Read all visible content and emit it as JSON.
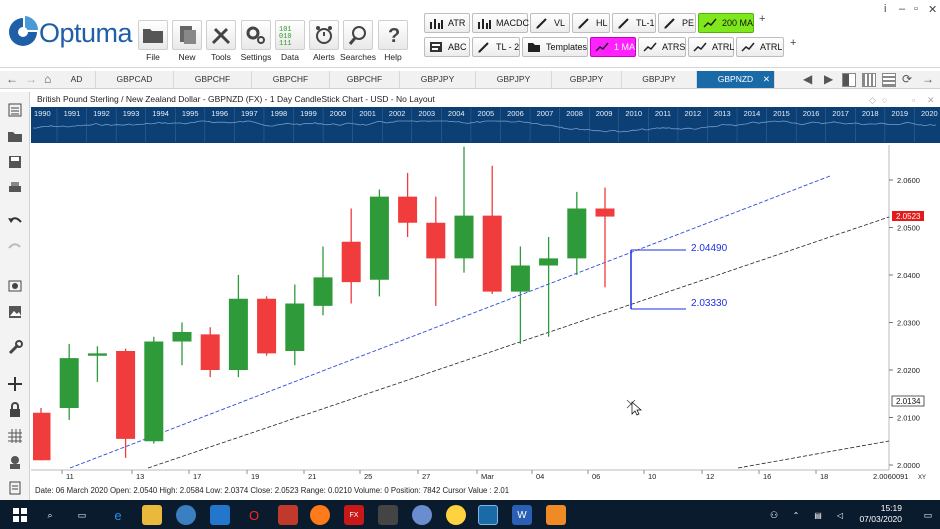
{
  "app": {
    "name": "Optuma"
  },
  "ribbon": {
    "buttons": [
      {
        "label": "File",
        "icon": "folder-icon"
      },
      {
        "label": "New",
        "icon": "new-page-icon"
      },
      {
        "label": "Tools",
        "icon": "tools-icon"
      },
      {
        "label": "Settings",
        "icon": "gears-icon"
      },
      {
        "label": "Data",
        "icon": "binary-data-icon"
      },
      {
        "label": "Alerts",
        "icon": "alarm-clock-icon"
      },
      {
        "label": "Searches",
        "icon": "magnifier-icon"
      },
      {
        "label": "Help",
        "icon": "question-icon"
      }
    ],
    "toolbar_row1": [
      "ATR",
      "MACDC",
      "VL",
      "HL",
      "TL-1",
      "PE",
      "200 MA"
    ],
    "toolbar_row2": [
      "ABC",
      "TL - 2",
      "Templates",
      "1 MA",
      "ATRS",
      "ATRL",
      "ATRL"
    ]
  },
  "tabs": [
    "AD",
    "GBPCAD",
    "GBPCHF",
    "GBPCHF",
    "GBPCHF",
    "GBPJPY",
    "GBPJPY",
    "GBPJPY",
    "GBPJPY",
    "GBPNZD"
  ],
  "active_tab": "GBPNZD",
  "chart_title": "British Pound Sterling / New Zealand Dollar - GBPNZD (FX) - 1 Day CandleStick Chart - USD - No Layout",
  "overview_years": [
    "1990",
    "1991",
    "1992",
    "1993",
    "1994",
    "1995",
    "1996",
    "1997",
    "1998",
    "1999",
    "2000",
    "2001",
    "2002",
    "2003",
    "2004",
    "2005",
    "2006",
    "2007",
    "2008",
    "2009",
    "2010",
    "2011",
    "2012",
    "2013",
    "2014",
    "2015",
    "2016",
    "2017",
    "2018",
    "2019",
    "2020"
  ],
  "price_labels": [
    "2.0600",
    "2.0500",
    "2.0400",
    "2.0300",
    "2.0200",
    "2.0100",
    "2.0000"
  ],
  "price_markers": {
    "last": "2.0523",
    "cursor": "2.0134"
  },
  "x_axis_bottom": "2.0060091",
  "x_axis_corner": "XY",
  "annotations": {
    "upper": "2.04490",
    "lower": "2.03330"
  },
  "status_text": "Date: 06 March 2020 Open: 2.0540 High: 2.0584 Low: 2.0374 Close: 2.0523 Range: 0.0210 Volume: 0 Position: 7842 Cursor Value : 2.01",
  "clock": {
    "time": "15:19",
    "date": "07/03/2020"
  },
  "colors": {
    "up": "#2e9a3a",
    "down": "#f03c3c",
    "overview_bg": "#0c3f74",
    "accent_green": "#7ee81c",
    "accent_magenta": "#ff22ff",
    "tab_active": "#1b6aa8",
    "taskbar": "#0b1b2e"
  },
  "chart_data": {
    "type": "candlestick",
    "x_tick_labels": [
      "11",
      "13",
      "17",
      "19",
      "21",
      "25",
      "27",
      "Mar",
      "04",
      "06",
      "10",
      "12",
      "16",
      "18"
    ],
    "ylim": [
      2.0,
      2.062
    ],
    "candles": [
      {
        "o": 2.011,
        "h": 2.012,
        "l": 2.001,
        "c": 2.001
      },
      {
        "o": 2.012,
        "h": 2.0255,
        "l": 2.0095,
        "c": 2.0225
      },
      {
        "o": 2.023,
        "h": 2.025,
        "l": 2.0175,
        "c": 2.0235
      },
      {
        "o": 2.024,
        "h": 2.0245,
        "l": 2.0015,
        "c": 2.0055
      },
      {
        "o": 2.005,
        "h": 2.027,
        "l": 2.0045,
        "c": 2.026
      },
      {
        "o": 2.026,
        "h": 2.03,
        "l": 2.021,
        "c": 2.028
      },
      {
        "o": 2.0275,
        "h": 2.029,
        "l": 2.0185,
        "c": 2.02
      },
      {
        "o": 2.02,
        "h": 2.04,
        "l": 2.0185,
        "c": 2.035
      },
      {
        "o": 2.035,
        "h": 2.0355,
        "l": 2.023,
        "c": 2.0235
      },
      {
        "o": 2.024,
        "h": 2.038,
        "l": 2.021,
        "c": 2.034
      },
      {
        "o": 2.0335,
        "h": 2.046,
        "l": 2.0315,
        "c": 2.0395
      },
      {
        "o": 2.047,
        "h": 2.054,
        "l": 2.034,
        "c": 2.0385
      },
      {
        "o": 2.039,
        "h": 2.058,
        "l": 2.0355,
        "c": 2.0565
      },
      {
        "o": 2.0565,
        "h": 2.0615,
        "l": 2.048,
        "c": 2.051
      },
      {
        "o": 2.051,
        "h": 2.0565,
        "l": 2.0335,
        "c": 2.0435
      },
      {
        "o": 2.0435,
        "h": 2.067,
        "l": 2.0405,
        "c": 2.0525
      },
      {
        "o": 2.0525,
        "h": 2.063,
        "l": 2.036,
        "c": 2.0365
      },
      {
        "o": 2.0365,
        "h": 2.046,
        "l": 2.0255,
        "c": 2.042
      },
      {
        "o": 2.042,
        "h": 2.048,
        "l": 2.027,
        "c": 2.0435
      },
      {
        "o": 2.0435,
        "h": 2.0575,
        "l": 2.04,
        "c": 2.054
      },
      {
        "o": 2.054,
        "h": 2.0584,
        "l": 2.0374,
        "c": 2.0523
      }
    ]
  }
}
